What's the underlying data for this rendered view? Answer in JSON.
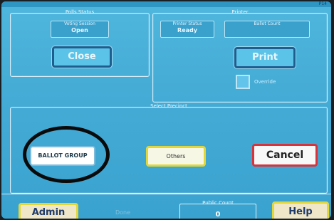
{
  "header": {
    "text": "P14"
  },
  "polls": {
    "title": "Polls Status",
    "status_label": "Voting Session",
    "status_value": "Open",
    "close_label": "Close"
  },
  "printer": {
    "title": "Printer",
    "status_label": "Printer Status",
    "status_value": "Ready",
    "ballot_label": "Ballot Count",
    "print_label": "Print",
    "override_label": "Override"
  },
  "precinct": {
    "title": "Select Precinct",
    "ballot_group_label": "BALLOT GROUP",
    "others_label": "Others",
    "cancel_label": "Cancel"
  },
  "footer": {
    "admin_label": "Admin",
    "status_text": "Done",
    "public_count_label": "Public Count",
    "public_count_value": "0",
    "help_label": "Help"
  }
}
